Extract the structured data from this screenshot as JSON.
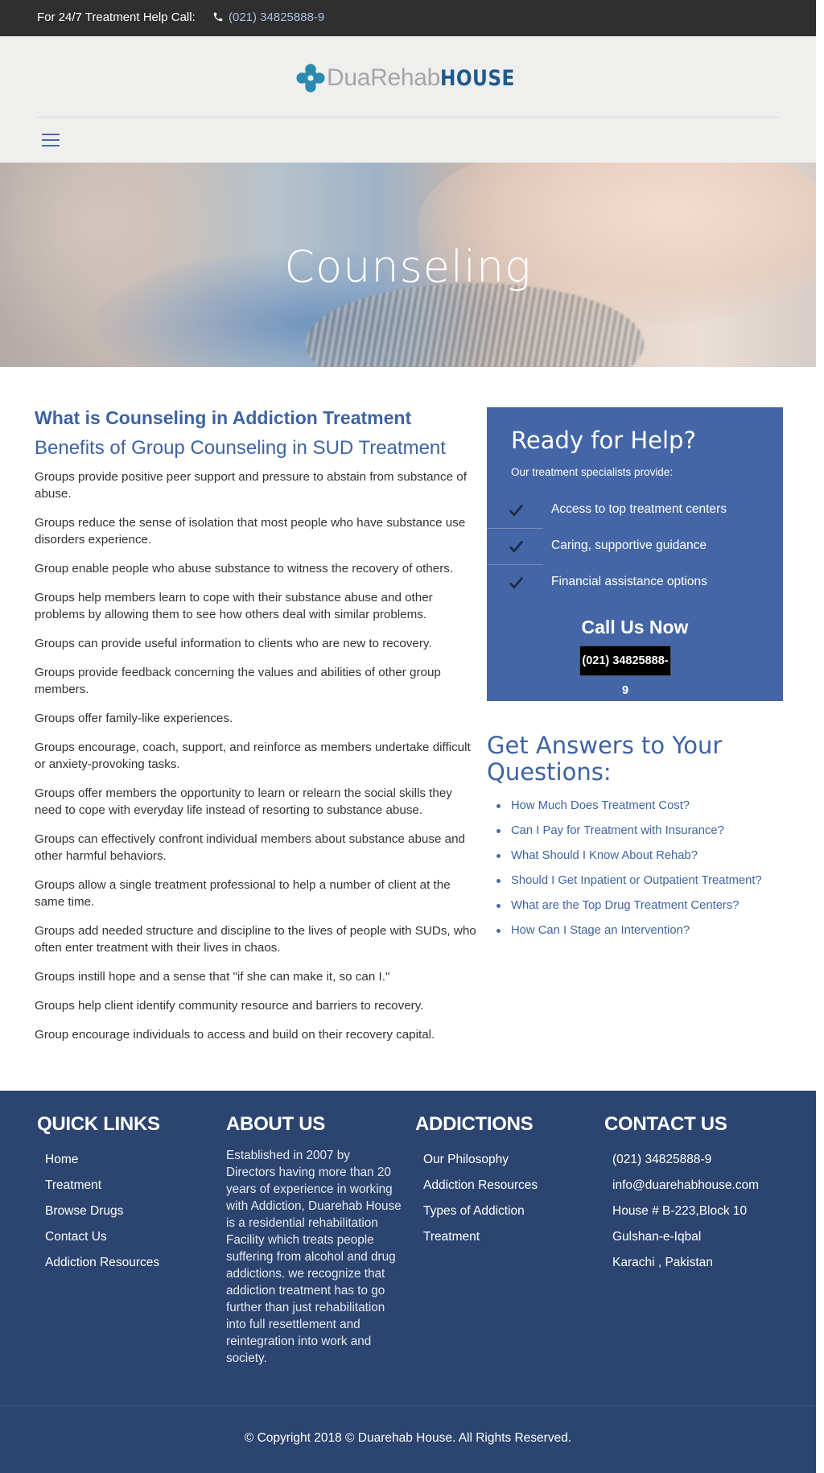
{
  "topbar": {
    "help_label": "For 24/7 Treatment Help Call:",
    "phone": "(021) 34825888-9"
  },
  "header": {
    "logo_part1": "DuaRehab",
    "logo_part2": "HOUSE"
  },
  "hero": {
    "title": "Counseling"
  },
  "main": {
    "heading": "What is Counseling in Addiction Treatment",
    "subheading": "Benefits of Group Counseling in SUD Treatment",
    "paragraphs": [
      "Groups provide positive peer support and pressure to abstain from substance of abuse.",
      "Groups reduce the sense of isolation that most people who have substance use disorders experience.",
      "Group enable people who abuse substance to witness the recovery of others.",
      "Groups help members learn to cope with their substance abuse and other problems by allowing them to see how others deal with similar problems.",
      "Groups can provide useful information to clients who are new to recovery.",
      "Groups provide feedback concerning the values and abilities of other group members.",
      "Groups offer family-like experiences.",
      "Groups encourage, coach, support, and reinforce as members undertake difficult or anxiety-provoking tasks.",
      "Groups offer members the opportunity to learn or relearn the social skills they need to cope with everyday life instead of resorting to substance abuse.",
      "Groups can effectively confront individual members about substance abuse and other harmful behaviors.",
      "Groups allow a single treatment professional to help a number of client at the same time.",
      "Groups add needed structure and discipline to the lives of people with SUDs, who often enter treatment with their lives in chaos.",
      "Groups instill hope and a sense that \"if she can make it, so can I.\"",
      "Groups help client identify community resource and barriers to recovery.",
      "Group encourage individuals to access and build on their recovery capital."
    ]
  },
  "helpbox": {
    "title": "Ready for Help?",
    "subtitle": "Our treatment specialists provide:",
    "items": [
      "Access to top treatment centers",
      "Caring, supportive guidance",
      "Financial assistance options"
    ],
    "call_label": "Call Us Now",
    "call_number": "(021) 34825888-9"
  },
  "answers": {
    "title": "Get Answers to Your Questions:",
    "links": [
      "How Much Does Treatment Cost?",
      "Can I Pay for Treatment with Insurance?",
      "What Should I Know About Rehab?",
      "Should I Get Inpatient or Outpatient Treatment?",
      "What are the Top Drug Treatment Centers?",
      "How Can I Stage an Intervention?"
    ]
  },
  "footer": {
    "quick_links": {
      "title": "QUICK LINKS",
      "items": [
        "Home",
        "Treatment",
        "Browse Drugs",
        "Contact Us",
        "Addiction Resources"
      ]
    },
    "about": {
      "title": "ABOUT US",
      "text": "Established in 2007 by Directors having more than 20 years of experience in working with Addiction, Duarehab House is a residential rehabilitation Facility which treats people suffering from alcohol and drug addictions. we recognize that addiction treatment has to go further than just rehabilitation into full resettlement and reintegration into work and society."
    },
    "addictions": {
      "title": "ADDICTIONS",
      "items": [
        "Our Philosophy",
        "Addiction Resources",
        "Types of Addiction",
        "Treatment"
      ]
    },
    "contact": {
      "title": "CONTACT US",
      "items": [
        "(021) 34825888-9",
        "info@duarehabhouse.com",
        "House # B-223,Block 10",
        "Gulshan-e-Iqbal",
        "Karachi , Pakistan"
      ]
    },
    "copyright": "© Copyright 2018 © Duarehab House. All Rights Reserved."
  },
  "colors": {
    "accent": "#3e63a2",
    "helpbox_bg": "#4466a6",
    "footer_bg": "#2c4470",
    "topbar_bg": "#2f2f2f",
    "logo_teal": "#2b8ab0"
  },
  "icons": {
    "topbar_phone": "phone-icon",
    "logo": "cross-logo-icon",
    "menu": "hamburger-menu-icon",
    "check": "checkmark-icon"
  }
}
